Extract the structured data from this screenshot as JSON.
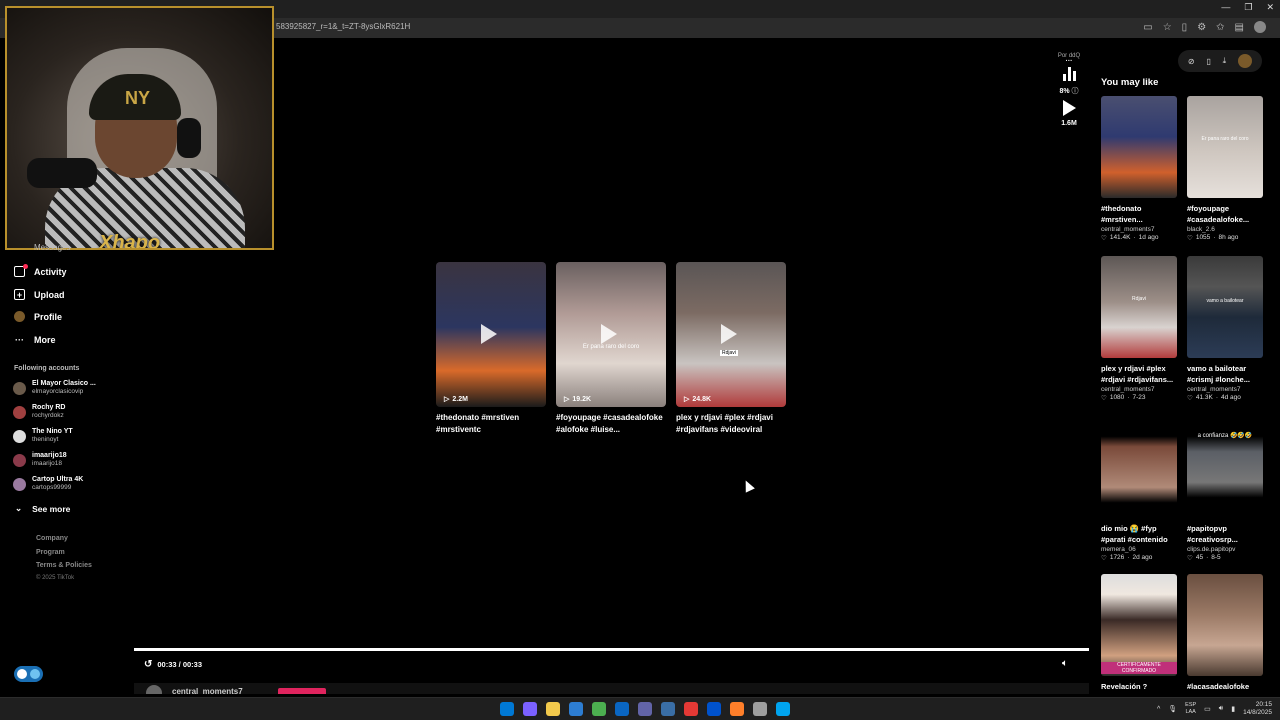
{
  "browser": {
    "url": "583925827_r=1&_t=ZT-8ysGlxR621H",
    "window_controls": [
      "—",
      "❐",
      "✕"
    ]
  },
  "webcam": {
    "brand_text": "Xhapo"
  },
  "sidebar": {
    "partial_label": "Messages",
    "nav": [
      {
        "label": "Activity",
        "icon": "activity-icon"
      },
      {
        "label": "Upload",
        "icon": "upload-icon"
      },
      {
        "label": "Profile",
        "icon": "profile-icon"
      },
      {
        "label": "More",
        "icon": "more-icon"
      }
    ],
    "following_title": "Following accounts",
    "accounts": [
      {
        "name": "El Mayor Clasico ...",
        "handle": "elmayorclasicovip"
      },
      {
        "name": "Rochy RD",
        "handle": "rochyrdokz"
      },
      {
        "name": "The Nino YT",
        "handle": "theninoyt"
      },
      {
        "name": "imaarijo18",
        "handle": "imaarijo18"
      },
      {
        "name": "Cartop Ultra 4K",
        "handle": "cartops99999"
      }
    ],
    "see_more": "See more",
    "footer": [
      "Company",
      "Program",
      "Terms & Policies"
    ],
    "copyright": "© 2025 TikTok"
  },
  "main": {
    "videos": [
      {
        "count": "2.2M",
        "title_line1": "#thedonato #mrstiven",
        "title_line2": "#mrstiventc",
        "overlay": ""
      },
      {
        "count": "19.2K",
        "title_line1": "#foyoupage #casadealofoke",
        "title_line2": "#alofoke #luise...",
        "overlay": "Er pana raro del coro"
      },
      {
        "count": "24.8K",
        "title_line1": "plex y rdjavi #plex #rdjavi",
        "title_line2": "#rdjavifans #videoviral",
        "overlay": "Rdjavi"
      }
    ],
    "actions": {
      "top_label": "Por ddQ",
      "percent": "8%",
      "plays": "1.6M"
    },
    "player": {
      "time": "00:33 / 00:33",
      "author": "central_moments7",
      "progress": 1.0
    }
  },
  "right_panel": {
    "title": "You may like",
    "items": [
      {
        "title1": "#thedonato",
        "title2": "#mrstiven...",
        "author": "central_moments7",
        "likes": "141.4K",
        "age": "1d ago",
        "overlay": ""
      },
      {
        "title1": "#foyoupage",
        "title2": "#casadealofoke...",
        "author": "black_2.6",
        "likes": "1055",
        "age": "8h ago",
        "overlay": "Er pana raro del coro"
      },
      {
        "title1": "plex y rdjavi #plex",
        "title2": "#rdjavi #rdjavifans...",
        "author": "central_moments7",
        "likes": "1080",
        "age": "7-23",
        "overlay": "Rdjavi"
      },
      {
        "title1": "vamo a bailotear",
        "title2": "#crismj #lonche...",
        "author": "central_moments7",
        "likes": "41.3K",
        "age": "4d ago",
        "overlay": "vamo a bailotear"
      },
      {
        "title1": "dio mio 😭 #fyp",
        "title2": "#parati #contenido",
        "author": "memera_06",
        "likes": "1726",
        "age": "2d ago",
        "overlay": ""
      },
      {
        "title1": "#papitopvp",
        "title2": "#creativosrp...",
        "author": "clips.de.papitopv",
        "likes": "45",
        "age": "8-5",
        "overlay": "a confianza 🤣🤣🤣"
      },
      {
        "title1": "Revelación ?",
        "title2": "",
        "author": "",
        "likes": "",
        "age": "",
        "overlay": "CERTIFICAMENTE CONFIRMADO"
      },
      {
        "title1": "#lacasadealofoke",
        "title2": "",
        "author": "",
        "likes": "",
        "age": "",
        "overlay": ""
      }
    ]
  },
  "taskbar": {
    "lang_line1": "ESP",
    "lang_line2": "LAA",
    "time": "20:15",
    "date": "14/8/2025",
    "icon_colors": [
      "#0078d4",
      "#7b61ff",
      "#f2c94c",
      "#2d7dd2",
      "#4caf50",
      "#0a66c2",
      "#6264a7",
      "#3a6ea5",
      "#e53935",
      "#0052cc",
      "#ff7f2a",
      "#9e9e9e",
      "#00a4ef"
    ]
  },
  "colors": {
    "accent": "#fe2c55",
    "webcam_border": "#b8902c",
    "toggle": "#1a6fb4"
  }
}
